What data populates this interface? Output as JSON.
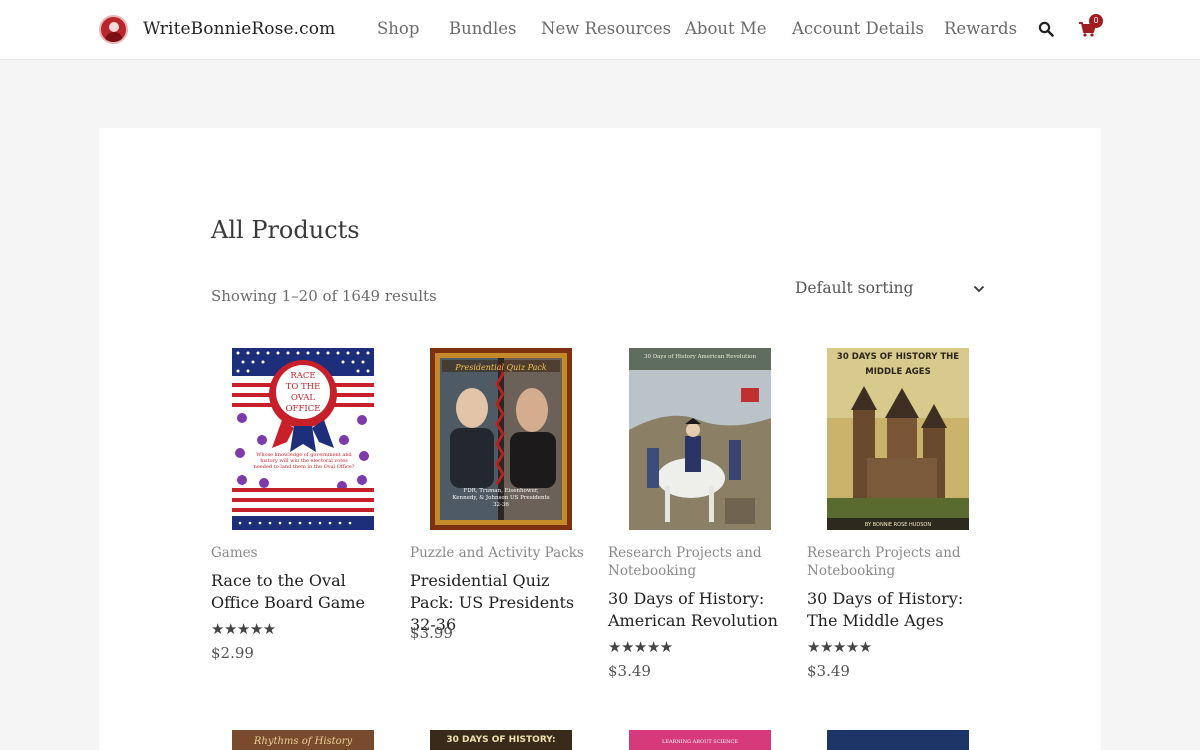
{
  "header": {
    "site_title": "WriteBonnieRose.com",
    "nav": [
      "Shop",
      "Bundles",
      "New Resources",
      "About Me",
      "Account Details",
      "Rewards"
    ],
    "cart_count": "0"
  },
  "page": {
    "title": "All Products",
    "result_count": "Showing 1–20 of 1649 results",
    "sort_selected": "Default sorting"
  },
  "products": [
    {
      "category": "Games",
      "name": "Race to the Oval Office Board Game",
      "rating": 5,
      "price": "$2.99",
      "cover_lines": [
        "RACE",
        "TO THE",
        "OVAL",
        "OFFICE"
      ],
      "cover_caption": "Whose knowledge of government and history will win the electoral votes needed to land them in the Oval Office?"
    },
    {
      "category": "Puzzle and Activity Packs",
      "name": "Presidential Quiz Pack: US Presidents 32-36",
      "rating": null,
      "price": "$3.99",
      "cover_title": "Presidential Quiz Pack",
      "cover_caption": "FDR, Truman, Eisenhower, Kennedy, & Johnson US Presidents 32-36"
    },
    {
      "category": "Research Projects and Notebooking",
      "name": "30 Days of History: American Revolution",
      "rating": 5,
      "price": "$3.49",
      "cover_title": "30 Days of History American Revolution"
    },
    {
      "category": "Research Projects and Notebooking",
      "name": "30 Days of History: The Middle Ages",
      "rating": 5,
      "price": "$3.49",
      "cover_title": "30 DAYS OF HISTORY THE MIDDLE AGES",
      "cover_caption": "BY BONNIE ROSE HUDSON"
    }
  ],
  "row2_covers": [
    {
      "title": "Rhythms of History"
    },
    {
      "title": "30 DAYS OF HISTORY:"
    },
    {
      "title": "LEARNING ABOUT SCIENCE"
    },
    {
      "title": ""
    }
  ]
}
